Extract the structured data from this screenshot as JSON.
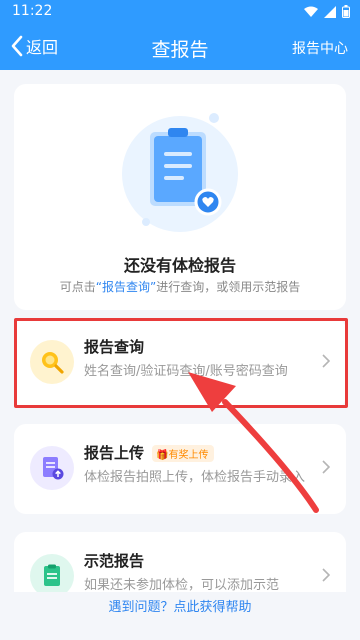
{
  "status": {
    "time": "11:22"
  },
  "nav": {
    "back_label": "返回",
    "title": "查报告",
    "right_label": "报告中心"
  },
  "empty": {
    "title": "还没有体检报告",
    "desc_prefix": "可点击",
    "desc_link": "“报告查询”",
    "desc_suffix": "进行查询，或领用示范报告"
  },
  "items": [
    {
      "title": "报告查询",
      "sub": "姓名查询/验证码查询/账号密码查询",
      "icon": "magnifier-icon",
      "icon_bg": "#fff3cf"
    },
    {
      "title": "报告上传",
      "badge": "有奖上传",
      "sub": "体检报告拍照上传，体检报告手动录入",
      "icon": "upload-document-icon",
      "icon_bg": "#eeebff"
    },
    {
      "title": "示范报告",
      "sub": "如果还未参加体检，可以添加示范",
      "icon": "sample-report-icon",
      "icon_bg": "#dff7ee"
    }
  ],
  "help": {
    "label": "遇到问题？点此获得帮助"
  },
  "colors": {
    "primary": "#2f9bff",
    "highlight": "#e83a3a",
    "arrow": "#ee3e3e"
  }
}
